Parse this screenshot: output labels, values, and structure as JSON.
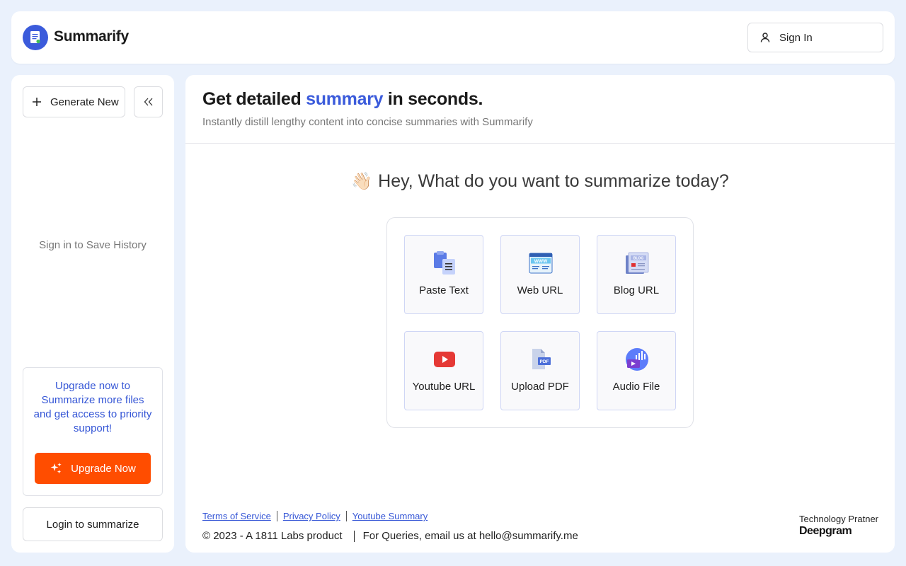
{
  "header": {
    "brand": "Summarify",
    "signin_label": "Sign In"
  },
  "sidebar": {
    "generate_label": "Generate New",
    "history_hint": "Sign in to Save History",
    "upgrade_text": "Upgrade now to Summarize more files and get access to priority support!",
    "upgrade_button": "Upgrade Now",
    "login_button": "Login to summarize"
  },
  "main": {
    "headline_pre": "Get detailed",
    "headline_accent": "summary",
    "headline_post": "in seconds.",
    "subline": "Instantly distill lengthy content into concise summaries with Summarify",
    "greeting_emoji": "👋🏻",
    "greeting": "Hey, What do you want to summarize today?",
    "options": [
      {
        "label": "Paste Text",
        "icon": "paste-text-icon"
      },
      {
        "label": "Web URL",
        "icon": "web-url-icon"
      },
      {
        "label": "Blog URL",
        "icon": "blog-url-icon"
      },
      {
        "label": "Youtube URL",
        "icon": "youtube-icon"
      },
      {
        "label": "Upload PDF",
        "icon": "pdf-icon"
      },
      {
        "label": "Audio File",
        "icon": "audio-file-icon"
      }
    ]
  },
  "footer": {
    "links": [
      "Terms of Service",
      "Privacy Policy",
      "Youtube Summary"
    ],
    "copyright": "© 2023 - A 1811 Labs product",
    "contact": "For Queries, email us at hello@summarify.me",
    "partner_label": "Technology Pratner",
    "partner_name": "Deepgram"
  },
  "colors": {
    "accent": "#3b5bdb",
    "upgrade": "#ff4d00",
    "background": "#eaf1fc"
  }
}
